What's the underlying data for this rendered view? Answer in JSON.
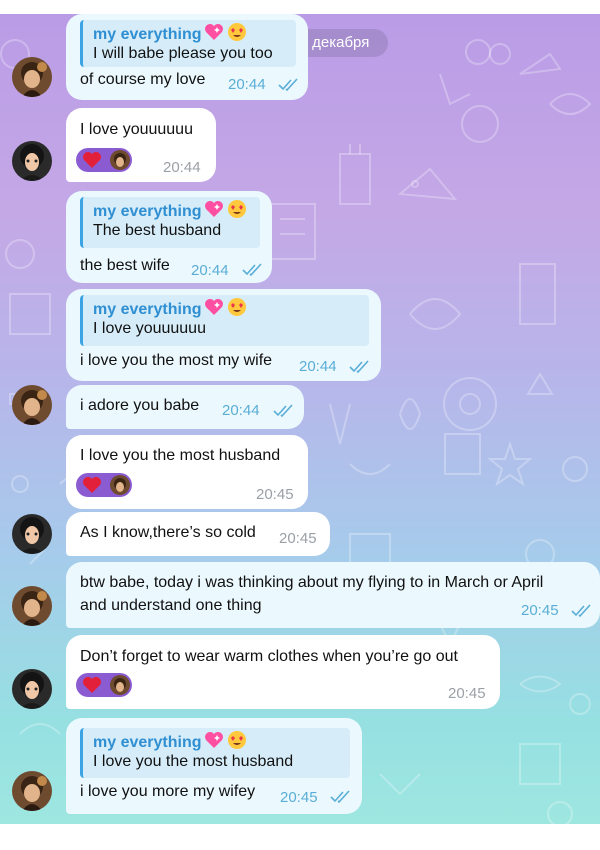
{
  "date_pill": "2 декабря",
  "reply_name": "my everything",
  "reaction": {
    "emoji": "heart"
  },
  "messages": [
    {
      "reply_text": "I will babe please you too",
      "text": "of course my love",
      "time": "20:44"
    },
    {
      "text": "I love youuuuuu",
      "time": "20:44"
    },
    {
      "reply_text": "The best husband",
      "text": "the best wife",
      "time": "20:44"
    },
    {
      "reply_text": "I love youuuuuu",
      "text": "i love you the most my wife",
      "time": "20:44"
    },
    {
      "text": "i adore you babe",
      "time": "20:44"
    },
    {
      "text": "I love you the most husband",
      "time": "20:45"
    },
    {
      "text": "As I know,there’s so cold",
      "time": "20:45"
    },
    {
      "text_line1": "btw babe, today i was thinking about my flying to in March or April",
      "text_line2": "and understand one thing",
      "time": "20:45"
    },
    {
      "text": "Don’t forget to wear warm clothes when you’re go out",
      "time": "20:45"
    },
    {
      "reply_text": "I love you the most husband",
      "text": "i love you more my wifey",
      "time": "20:45"
    }
  ],
  "colors": {
    "accent": "#3ca3e4",
    "outgoing_bubble": "#ebf8fe",
    "incoming_bubble": "#ffffff",
    "reaction_bg": "#8b5bd2"
  }
}
